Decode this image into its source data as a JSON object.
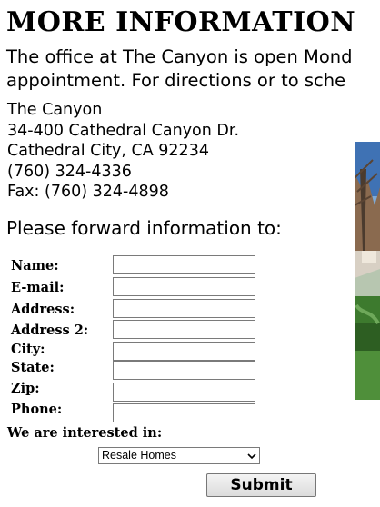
{
  "title": "MORE INFORMATION",
  "intro": {
    "line1": "The office at The Canyon is open Mond",
    "line2": "appointment. For directions or to sche"
  },
  "address": {
    "name": "The Canyon",
    "street": "34-400 Cathedral Canyon Dr.",
    "city": "Cathedral City, CA 92234",
    "phone": "(760) 324-4336",
    "fax": "Fax: (760) 324-4898"
  },
  "form": {
    "heading": "Please forward information to:",
    "fields": {
      "name": "Name:",
      "email": "E-mail:",
      "address": "Address:",
      "address2": "Address 2:",
      "city": "City:",
      "state": "State:",
      "zip": "Zip:",
      "phone": "Phone:"
    },
    "interest_label": "We are interested in:",
    "interest_selected": "Resale Homes",
    "submit_label": "Submit"
  },
  "colors": {
    "page_background": "#ffffff",
    "text": "#000000",
    "field_border": "#7a7a7a"
  }
}
